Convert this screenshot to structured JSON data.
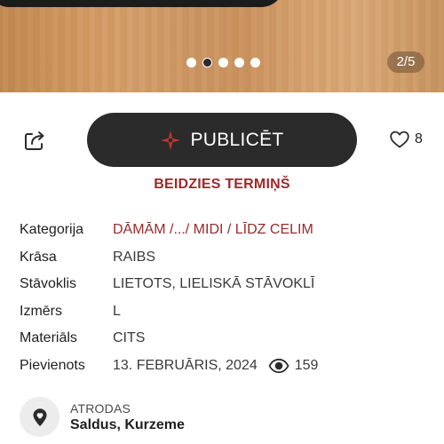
{
  "gallery": {
    "dot_count": 5,
    "active_index": 1,
    "counter": "2/5"
  },
  "actions": {
    "share_icon": "share-icon",
    "publish_label": "PUBLICĒT",
    "publish_icon": "spark-icon",
    "publish_icon_color": "#c0392b",
    "favorite_icon": "heart-outline-icon",
    "favorite_count": "8"
  },
  "status": {
    "text": "BEIDZIES TERMIŅŠ",
    "color": "#9b2a2a"
  },
  "details": {
    "category": {
      "label": "Kategorija",
      "value": "DĀMĀM /.../ MIDI / LĪDZ CELIM"
    },
    "color": {
      "label": "Krāsa",
      "value": "RAIBS"
    },
    "condition": {
      "label": "Stāvoklis",
      "value": "LIETOTS, LIELISKĀ STĀVOKLĪ"
    },
    "size": {
      "label": "Izmērs",
      "value": "L"
    },
    "material": {
      "label": "Materiāls",
      "value": "CITS"
    },
    "added": {
      "label": "Pievienots",
      "value": "13. FEBRUĀRIS, 2024",
      "views_icon": "eye-icon",
      "views": "159"
    }
  },
  "location": {
    "icon": "location-pin-icon",
    "label": "ATRODAS",
    "value": "Saldus, Kurzeme"
  }
}
